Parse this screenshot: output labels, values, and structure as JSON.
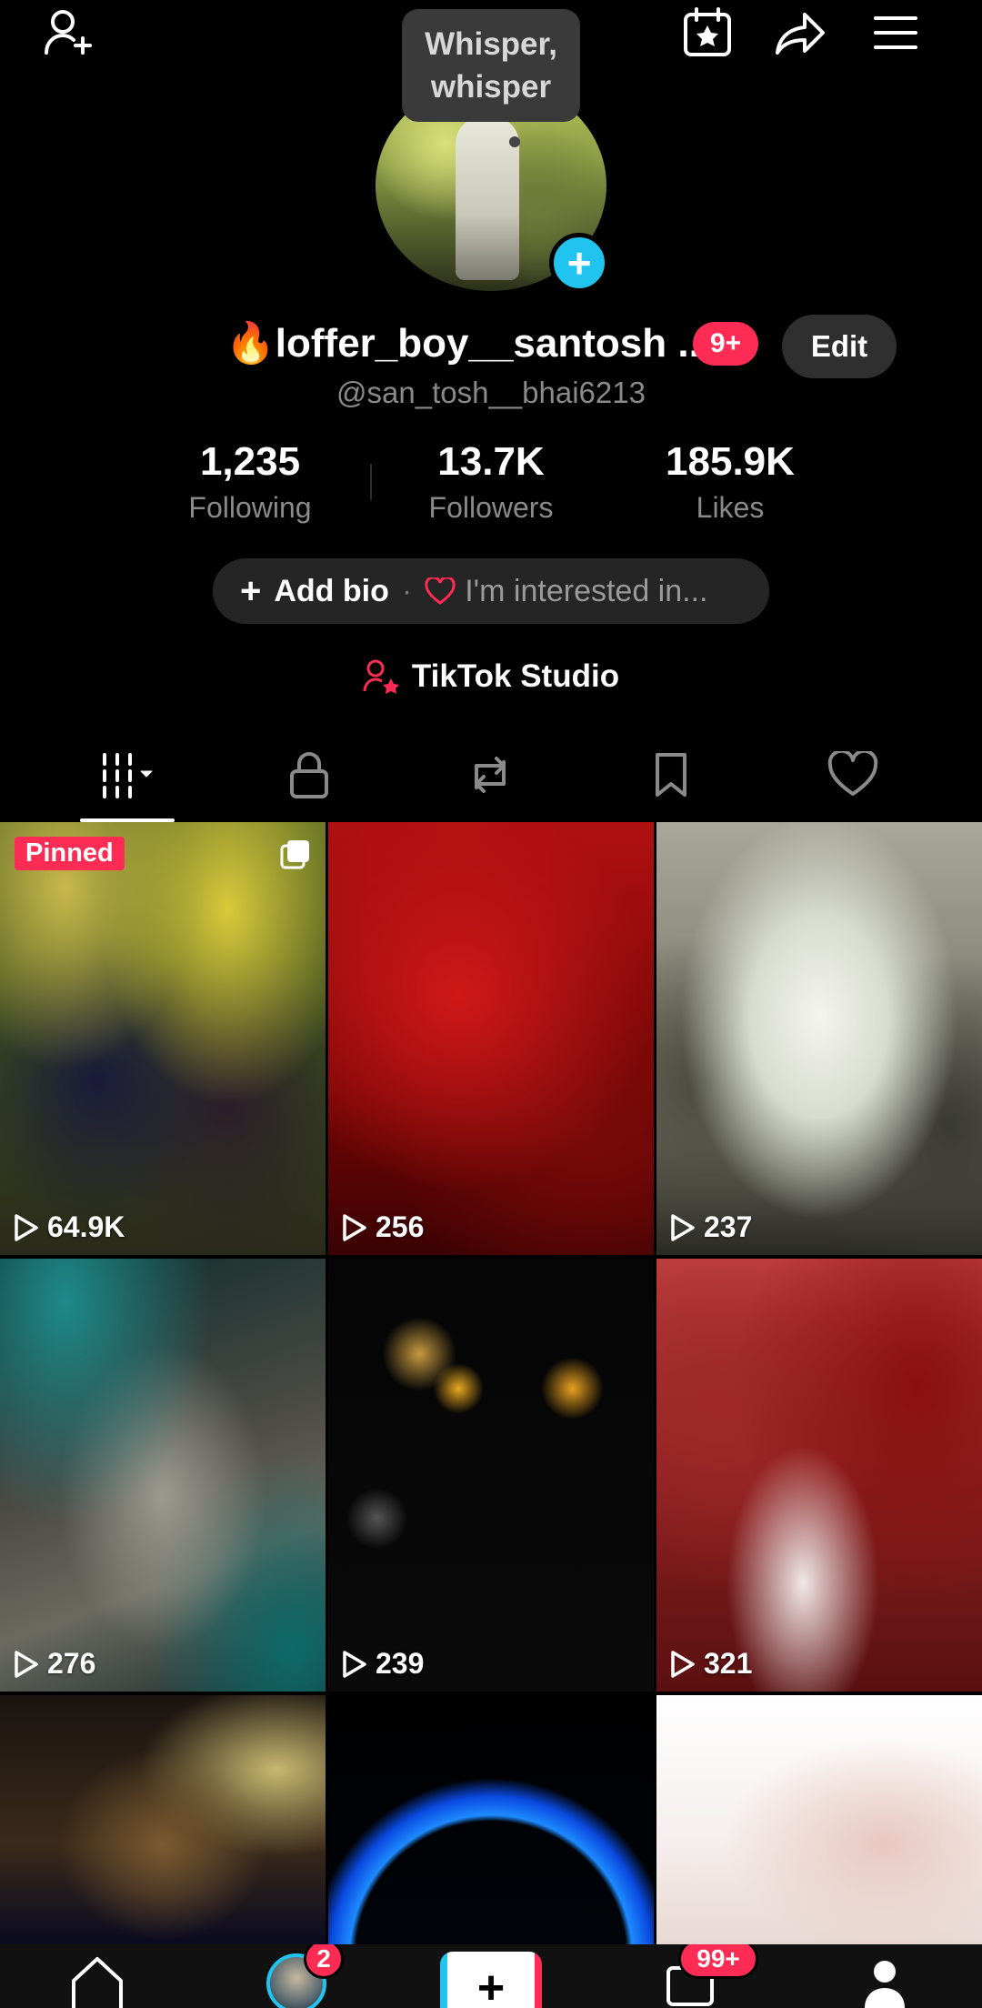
{
  "header": {
    "icons": [
      "add-friend-icon",
      "calendar-star-icon",
      "share-icon",
      "menu-icon"
    ]
  },
  "whisper": {
    "line1": "Whisper,",
    "line2": "whisper"
  },
  "profile": {
    "display_name": "loffer_boy__santosh ..",
    "name_emoji": "🔥",
    "notif_badge": "9+",
    "edit_label": "Edit",
    "handle": "@san_tosh__bhai6213",
    "stats": [
      {
        "value": "1,235",
        "label": "Following"
      },
      {
        "value": "13.7K",
        "label": "Followers"
      },
      {
        "value": "185.9K",
        "label": "Likes"
      }
    ],
    "bio": {
      "plus": "+",
      "add_bio": "Add bio",
      "separator": "·",
      "interest": "I'm interested in..."
    },
    "studio_label": "TikTok Studio"
  },
  "tabs": [
    "videos-grid-icon",
    "lock-icon",
    "repost-icon",
    "bookmark-icon",
    "heart-icon"
  ],
  "videos": [
    {
      "views": "64.9K",
      "pinned": "Pinned"
    },
    {
      "views": "256"
    },
    {
      "views": "237"
    },
    {
      "views": "276"
    },
    {
      "views": "239"
    },
    {
      "views": "321"
    },
    {},
    {},
    {}
  ],
  "bottom_nav": {
    "inbox_badge": "2",
    "messages_badge": "99+"
  },
  "colors": {
    "accent": "#fe2c55",
    "cyan": "#20c4ee",
    "background": "#000000"
  }
}
